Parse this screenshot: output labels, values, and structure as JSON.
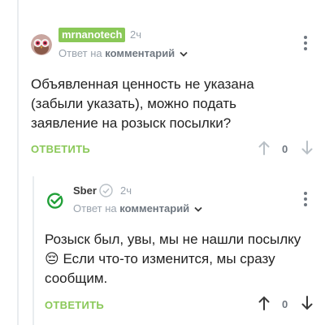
{
  "comments": [
    {
      "author": "mrnanotech",
      "time": "2ч",
      "reply_prefix": "Ответ на",
      "reply_target": "комментарий",
      "text": "Объявленная ценность не указана (забыли указать), можно подать заявление на розыск посылки?",
      "reply_label": "ОТВЕТИТЬ",
      "rating": "0"
    },
    {
      "author": "Sber",
      "time": "2ч",
      "reply_prefix": "Ответ на",
      "reply_target": "комментарий",
      "text": "Розыск был, увы, мы не нашли посылку 😔 Если что-то изменится, мы сразу сообщим.",
      "reply_label": "ОТВЕТИТЬ",
      "rating": "0"
    }
  ],
  "colors": {
    "accent_green": "#8ac858",
    "sber_green": "#21a038",
    "muted": "#9aa3ad",
    "text": "#222222"
  },
  "icons": [
    "owl-avatar",
    "sber-logo-icon",
    "verified-check-icon",
    "chevron-down-icon",
    "kebab-menu-icon",
    "arrow-up-icon",
    "arrow-down-icon"
  ]
}
